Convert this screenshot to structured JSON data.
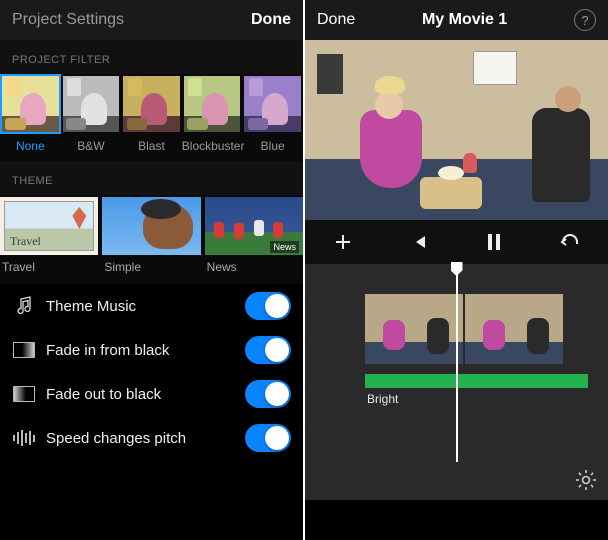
{
  "left": {
    "title": "Project Settings",
    "done": "Done",
    "filters_label": "PROJECT FILTER",
    "filters": [
      {
        "name": "None"
      },
      {
        "name": "B&W"
      },
      {
        "name": "Blast"
      },
      {
        "name": "Blockbuster"
      },
      {
        "name": "Blue"
      }
    ],
    "theme_label": "THEME",
    "themes": [
      {
        "name": "Travel"
      },
      {
        "name": "Simple"
      },
      {
        "name": "News"
      }
    ],
    "toggles": {
      "theme_music": "Theme Music",
      "fade_in": "Fade in from black",
      "fade_out": "Fade out to black",
      "speed_pitch": "Speed changes pitch"
    }
  },
  "right": {
    "done": "Done",
    "title": "My Movie 1",
    "help": "?",
    "audio_label": "Bright",
    "news_badge": "News"
  }
}
